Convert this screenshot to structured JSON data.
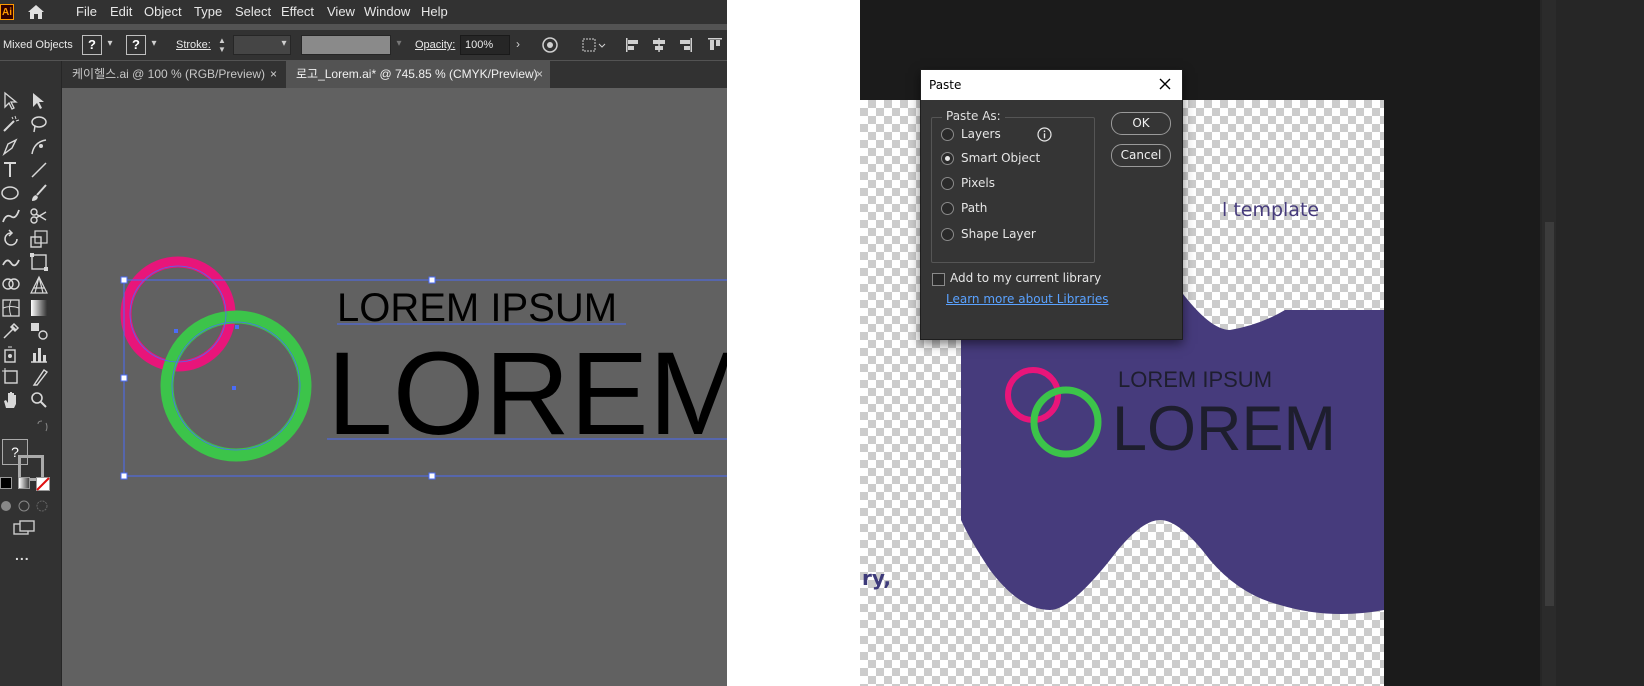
{
  "illustrator": {
    "logo_text": "Ai",
    "menu": [
      "File",
      "Edit",
      "Object",
      "Type",
      "Select",
      "Effect",
      "View",
      "Window",
      "Help"
    ],
    "control_bar": {
      "selection_label": "Mixed Objects",
      "fill_symbol": "?",
      "stroke_symbol": "?",
      "stroke_label": "Stroke:",
      "opacity_label": "Opacity:",
      "opacity_value": "100%"
    },
    "tabs": [
      {
        "label": "케이헬스.ai @ 100 % (RGB/Preview)",
        "close": "×"
      },
      {
        "label": "로고_Lorem.ai* @ 745.85 % (CMYK/Preview)",
        "close": "×"
      }
    ],
    "toolbar": {
      "fill_stroke_symbol": "?",
      "more_label": "..."
    },
    "artwork": {
      "subtitle": "LOREM IPSUM",
      "title": "LOREM",
      "colors": {
        "ring_pink": "#e8157a",
        "ring_green": "#3cc44a",
        "text": "#000000",
        "selection": "#4a6cf7"
      }
    }
  },
  "photoshop": {
    "template_text": "l template",
    "partial_text": "ry,",
    "logo": {
      "subtitle": "LOREM IPSUM",
      "title": "LOREM",
      "colors": {
        "shape": "#463b7c",
        "ring_pink": "#e8157a",
        "ring_green": "#3cc44a",
        "text": "#1e1e2e"
      }
    }
  },
  "paste_dialog": {
    "title": "Paste",
    "group_label": "Paste As:",
    "options": [
      {
        "label": "Layers",
        "selected": false
      },
      {
        "label": "Smart Object",
        "selected": true
      },
      {
        "label": "Pixels",
        "selected": false
      },
      {
        "label": "Path",
        "selected": false
      },
      {
        "label": "Shape Layer",
        "selected": false
      }
    ],
    "ok_label": "OK",
    "cancel_label": "Cancel",
    "library_checkbox_label": "Add to my current library",
    "learn_more_link": "Learn more about Libraries"
  }
}
